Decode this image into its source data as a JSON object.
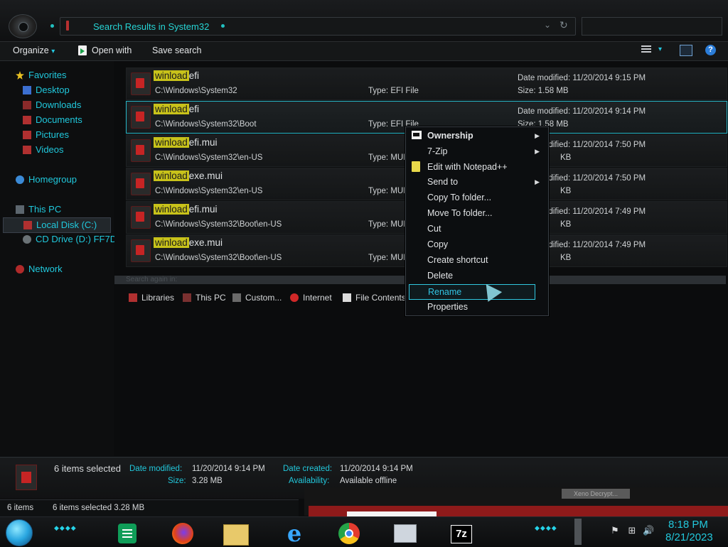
{
  "window": {
    "address": "Search Results in System32",
    "addr_dropdown": "⌄",
    "addr_refresh": "↻"
  },
  "toolbar": {
    "organize": "Organize",
    "organize_arrow": "▾",
    "open_with": "Open with",
    "save_search": "Save search",
    "view_arrow": "▾",
    "help": "?"
  },
  "nav": {
    "favorites": "Favorites",
    "desktop": "Desktop",
    "downloads": "Downloads",
    "documents": "Documents",
    "pictures": "Pictures",
    "videos": "Videos",
    "homegroup": "Homegroup",
    "this_pc": "This PC",
    "local_disk": "Local Disk (C:)",
    "cd_drive": "CD Drive (D:) FF7D",
    "network": "Network"
  },
  "files": [
    {
      "name_hl": "winload",
      "name_rest": "efi",
      "path": "C:\\Windows\\System32",
      "type": "Type: EFI File",
      "date": "Date modified: 11/20/2014 9:15 PM",
      "size": "Size: 1.58 MB"
    },
    {
      "name_hl": "winload",
      "name_rest": "efi",
      "path": "C:\\Windows\\System32\\Boot",
      "type": "Type: EFI File",
      "date": "Date modified: 11/20/2014 9:14 PM",
      "size": "Size: 1.58 MB"
    },
    {
      "name_hl": "winload",
      "name_rest": "efi.mui",
      "path": "C:\\Windows\\System32\\en-US",
      "type": "Type: MUI",
      "date": "Date modified: 11/20/2014 7:50 PM",
      "size": "KB"
    },
    {
      "name_hl": "winload",
      "name_rest": "exe.mui",
      "path": "C:\\Windows\\System32\\en-US",
      "type": "Type: MUI",
      "date": "Date modified: 11/20/2014 7:50 PM",
      "size": "KB"
    },
    {
      "name_hl": "winload",
      "name_rest": "efi.mui",
      "path": "C:\\Windows\\System32\\Boot\\en-US",
      "type": "Type: MUI",
      "date": "Date modified: 11/20/2014 7:49 PM",
      "size": "KB"
    },
    {
      "name_hl": "winload",
      "name_rest": "exe.mui",
      "path": "C:\\Windows\\System32\\Boot\\en-US",
      "type": "Type: MUI",
      "date": "Date modified: 11/20/2014 7:49 PM",
      "size": "KB"
    }
  ],
  "search_again": {
    "label": "Search again in:",
    "libraries": "Libraries",
    "this_pc": "This PC",
    "custom": "Custom...",
    "internet": "Internet",
    "file_contents": "File Contents"
  },
  "context_menu": {
    "ownership": "Ownership",
    "seven_zip": "7-Zip",
    "edit_notepad": "Edit with Notepad++",
    "send_to": "Send to",
    "copy_to_folder": "Copy To folder...",
    "move_to_folder": "Move To folder...",
    "cut": "Cut",
    "copy": "Copy",
    "create_shortcut": "Create shortcut",
    "delete": "Delete",
    "rename": "Rename",
    "properties": "Properties",
    "submenu_arrow": "▶"
  },
  "details": {
    "selected": "6 items selected",
    "date_modified_key": "Date modified:",
    "date_modified_val": "11/20/2014 9:14 PM",
    "date_created_key": "Date created:",
    "date_created_val": "11/20/2014 9:14 PM",
    "size_key": "Size:",
    "size_val": "3.28 MB",
    "availability_key": "Availability:",
    "availability_val": "Available offline"
  },
  "status": {
    "items": "6 items",
    "selected": "6 items selected  3.28 MB"
  },
  "background_window": {
    "label": "Xeno Decrypt..."
  },
  "taskbar": {
    "dots": "◆◆◆◆",
    "seven_zip_label": "7z",
    "ie_label": "e",
    "time": "8:18 PM",
    "date": "8/21/2023",
    "tray_flag": "⚑",
    "tray_network": "⊞",
    "tray_volume": "🔊"
  },
  "colors": {
    "accent": "#22c8dc",
    "highlight": "#c8c21a",
    "selection_border": "#27b7c8"
  }
}
